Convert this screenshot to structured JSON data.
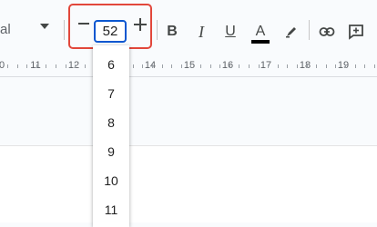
{
  "toolbar": {
    "font_name": "al",
    "decrease_symbol": "−",
    "font_size": "52",
    "bold": "B",
    "italic": "I",
    "underline": "U",
    "text_color": "A",
    "highlight_color": "#e2473b",
    "icons": [
      "font-dropdown-caret-icon",
      "minus-icon",
      "plus-icon",
      "highlighter-icon",
      "link-icon",
      "add-comment-icon"
    ]
  },
  "ruler": {
    "labels": [
      "0",
      "11",
      "12",
      "13",
      "14",
      "15",
      "16",
      "17",
      "18",
      "19"
    ]
  },
  "dropdown": {
    "items": [
      "6",
      "7",
      "8",
      "9",
      "10",
      "11"
    ]
  }
}
